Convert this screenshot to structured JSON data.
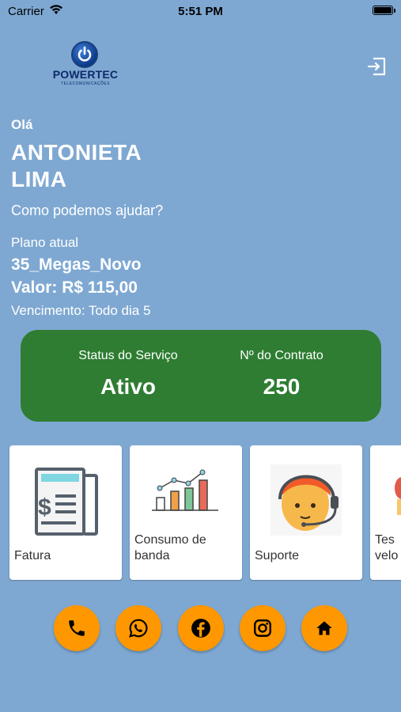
{
  "status_bar": {
    "carrier": "Carrier",
    "time": "5:51 PM"
  },
  "logo": {
    "brand": "POWERTEC",
    "tagline": "TELECOMUNICAÇÕES"
  },
  "greeting": {
    "hello": "Olá",
    "name_line1": "ANTONIETA",
    "name_line2": "LIMA",
    "help": "Como podemos ajudar?"
  },
  "plan": {
    "label": "Plano atual",
    "name": "35_Megas_Novo",
    "value": "Valor: R$ 115,00",
    "due": "Vencimento: Todo dia 5"
  },
  "service": {
    "status_label": "Status do Serviço",
    "status_value": "Ativo",
    "contract_label": "Nº do Contrato",
    "contract_value": "250",
    "card_color": "#2e7d32"
  },
  "tiles": [
    {
      "label": "Fatura",
      "icon": "invoice-icon"
    },
    {
      "label_line1": "Consumo de",
      "label_line2": "banda",
      "icon": "bandwidth-chart-icon"
    },
    {
      "label": "Suporte",
      "icon": "support-agent-icon"
    },
    {
      "label_line1": "Tes",
      "label_line2": "velo",
      "icon": "speed-test-icon"
    }
  ],
  "social": {
    "accent": "#ff9800",
    "buttons": [
      "phone-icon",
      "whatsapp-icon",
      "facebook-icon",
      "instagram-icon",
      "home-icon"
    ]
  },
  "colors": {
    "background": "#7ea8d2",
    "text": "#ffffff"
  }
}
